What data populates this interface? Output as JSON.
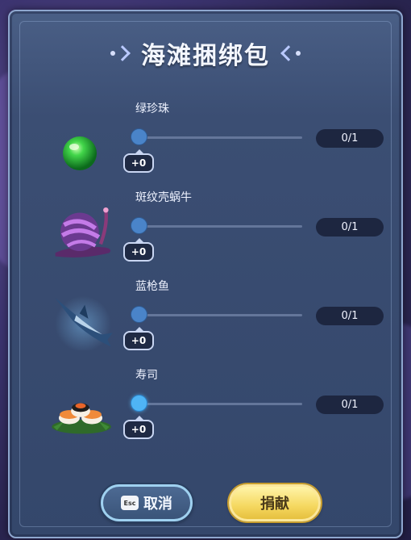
{
  "dialog": {
    "title": "海滩捆绑包"
  },
  "items": [
    {
      "name": "绿珍珠",
      "added": "+0",
      "count": "0/1",
      "icon": "green-pearl-icon",
      "slider_fraction": 0
    },
    {
      "name": "斑纹壳蜗牛",
      "added": "+0",
      "count": "0/1",
      "icon": "striped-snail-icon",
      "slider_fraction": 0
    },
    {
      "name": "蓝枪鱼",
      "added": "+0",
      "count": "0/1",
      "icon": "blue-marlin-icon",
      "slider_fraction": 0
    },
    {
      "name": "寿司",
      "added": "+0",
      "count": "0/1",
      "icon": "sushi-icon",
      "slider_fraction": 0
    }
  ],
  "buttons": {
    "cancel_key": "Esc",
    "cancel_label": "取消",
    "donate_label": "捐献"
  },
  "colors": {
    "panel": "#3b4e73",
    "accent_blue": "#4fb4f5",
    "donate_gold": "#f5d860"
  }
}
